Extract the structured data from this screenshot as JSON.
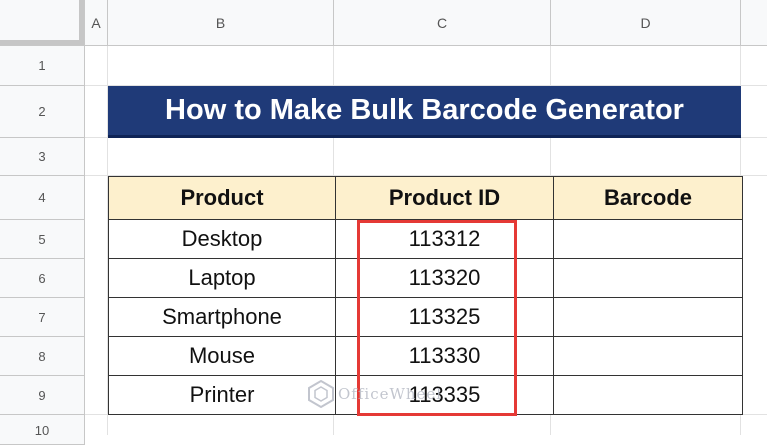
{
  "sheet": {
    "columns": [
      "A",
      "B",
      "C",
      "D"
    ],
    "rows": [
      "1",
      "2",
      "3",
      "4",
      "5",
      "6",
      "7",
      "8",
      "9",
      "10"
    ]
  },
  "title": "How to Make Bulk Barcode Generator",
  "table": {
    "headers": [
      "Product",
      "Product ID",
      "Barcode"
    ],
    "rows": [
      {
        "product": "Desktop",
        "id": "113312",
        "barcode": ""
      },
      {
        "product": "Laptop",
        "id": "113320",
        "barcode": ""
      },
      {
        "product": "Smartphone",
        "id": "113325",
        "barcode": ""
      },
      {
        "product": "Mouse",
        "id": "113330",
        "barcode": ""
      },
      {
        "product": "Printer",
        "id": "113335",
        "barcode": ""
      }
    ]
  },
  "highlight": {
    "color": "#e53935"
  },
  "watermark": {
    "text": "OfficeWheel"
  },
  "colors": {
    "banner": "#1f3a78",
    "header_fill": "#fdf0cd"
  }
}
